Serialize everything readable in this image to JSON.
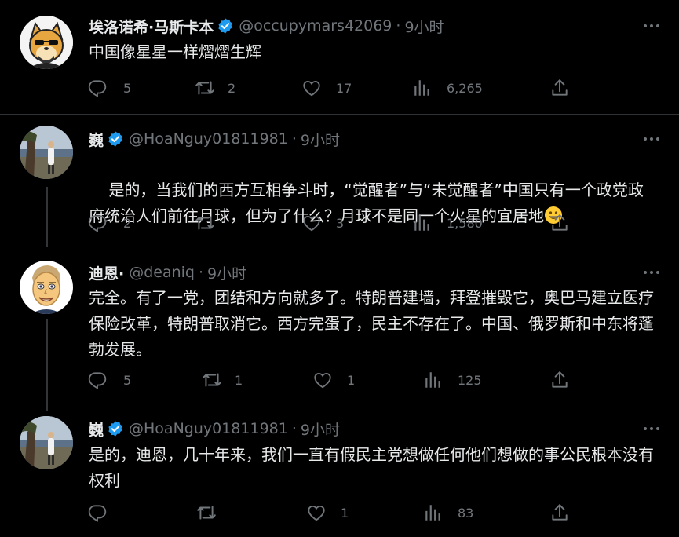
{
  "tweets": [
    {
      "name": "埃洛诺希·马斯卡本",
      "handle": "@occupymars42069",
      "dot": "·",
      "time": "9小时",
      "text": "中国像星星一样熠熠生辉",
      "replies": "5",
      "retweets": "2",
      "likes": "17",
      "views": "6,265",
      "avatar": "shiba-dog-avatar"
    },
    {
      "name": "巍",
      "handle": "@HoaNguy01811981",
      "dot": "·",
      "time": "9小时",
      "text": "是的，当我们的西方互相争斗时，“觉醒者”与“未觉醒者”中国只有一个政党政府统治人们前往月球，但为了什么？月球不是同一个火星的宜居地",
      "emoji": "grinning-face-emoji",
      "replies": "2",
      "retweets": "",
      "likes": "3",
      "views": "1,580",
      "avatar": "photo-avatar"
    },
    {
      "name": "迪恩·",
      "handle": "@deaniq",
      "dot": "·",
      "time": "9小时",
      "text": "完全。有了一党，团结和方向就多了。特朗普建墙，拜登摧毁它，奥巴马建立医疗保险改革，特朗普取消它。西方完蛋了，民主不存在了。中国、俄罗斯和中东将蓬勃发展。",
      "replies": "5",
      "retweets": "1",
      "likes": "1",
      "views": "125",
      "avatar": "cartoon-man-avatar"
    },
    {
      "name": "巍",
      "handle": "@HoaNguy01811981",
      "dot": "·",
      "time": "9小时",
      "text": "是的，迪恩，几十年来，我们一直有假民主党想做任何他们想做的事公民根本没有权利",
      "replies": "",
      "retweets": "",
      "likes": "1",
      "views": "83",
      "avatar": "photo-avatar"
    }
  ],
  "colors": {
    "background": "#000000",
    "text": "#e7e9ea",
    "muted": "#71767b",
    "verified": "#1d9bf0",
    "divider": "#2f3336"
  }
}
